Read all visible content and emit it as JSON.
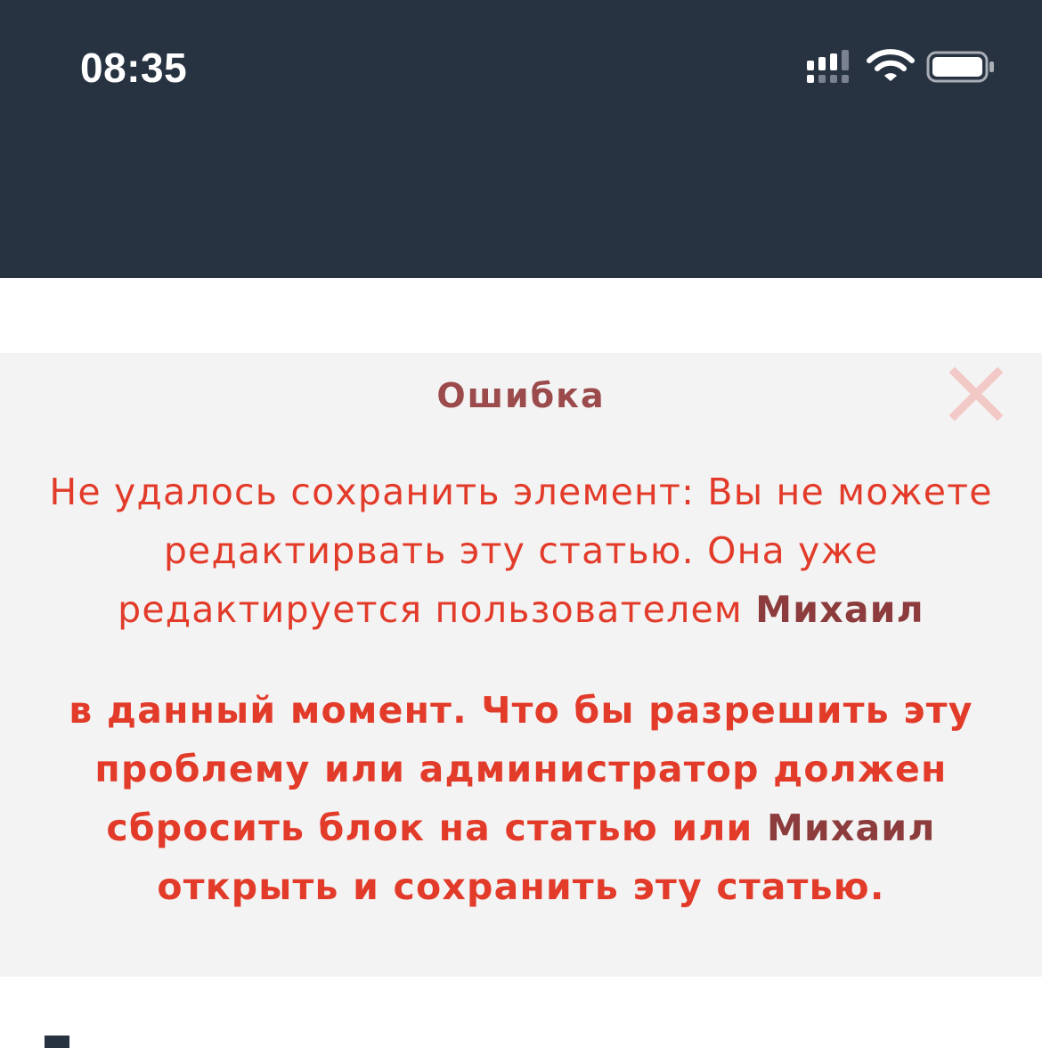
{
  "status_bar": {
    "time": "08:35",
    "icons": [
      "signal-icon",
      "wifi-icon",
      "battery-icon"
    ],
    "background": "#283342"
  },
  "alert": {
    "title": "Ошибка",
    "close_icon": "close-icon",
    "message_part1": "Не удалось сохранить элемент: Вы не можете редактирвать эту статью. Она уже редактируется пользователем ",
    "user_name": "Михаил",
    "message_part2": "в данный момент. Что бы разрешить эту проблему или администратор должен сбросить блок на статью или ",
    "message_part3": " открыть и сохранить эту статью.",
    "colors": {
      "background": "#f4f3f3",
      "title": "#9b4b4b",
      "message": "#e23b2a",
      "user_name": "#8c3c3c",
      "close_icon": "#f2c9c6"
    }
  }
}
